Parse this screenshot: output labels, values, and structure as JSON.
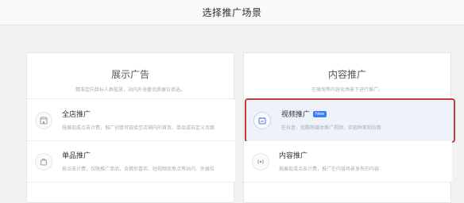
{
  "header": {
    "title": "选择推广场景"
  },
  "panels": [
    {
      "title": "展示广告",
      "desc": "精准定向目标人群投放，站内外海量优质展位供选。",
      "items": [
        {
          "name": "全店推广",
          "desc": "按展现或点击计费，推广创意可链接至店铺内的首页、单品或自定义页面",
          "icon": "store-icon"
        },
        {
          "name": "单品推广",
          "desc": "按点击计费，仅限推广单品，含猜你喜欢、短视频及焦点等站内、外展位",
          "icon": "bag-icon"
        }
      ]
    },
    {
      "title": "内容推广",
      "desc": "在微淘等内容化场景下进行推广。",
      "items": [
        {
          "name": "视频推广",
          "badge": "New",
          "desc": "在抖音、优酷等媒体推广视频，实现种草和拉新",
          "icon": "video-calendar-icon"
        },
        {
          "name": "内容推广",
          "desc": "按展现或点击计费，推广在内容场景发布的内容",
          "icon": "broadcast-icon"
        }
      ]
    }
  ]
}
